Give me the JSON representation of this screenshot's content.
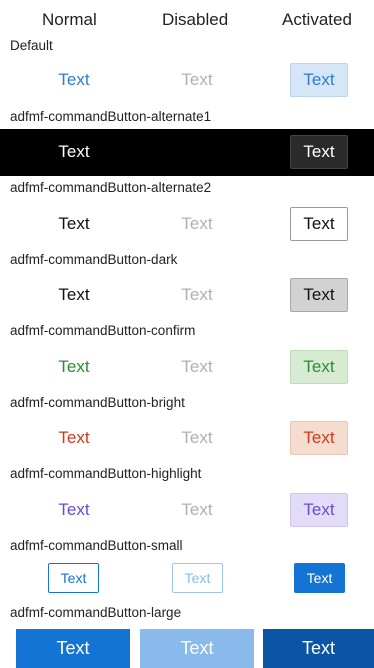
{
  "header": {
    "normal": "Normal",
    "disabled": "Disabled",
    "activated": "Activated"
  },
  "rows": [
    {
      "label": "Default",
      "normal": "Text",
      "disabled": "Text",
      "activated": "Text"
    },
    {
      "label": "adfmf-commandButton-alternate1",
      "normal": "Text",
      "disabled": "Text",
      "activated": "Text"
    },
    {
      "label": "adfmf-commandButton-alternate2",
      "normal": "Text",
      "disabled": "Text",
      "activated": "Text"
    },
    {
      "label": "adfmf-commandButton-dark",
      "normal": "Text",
      "disabled": "Text",
      "activated": "Text"
    },
    {
      "label": "adfmf-commandButton-confirm",
      "normal": "Text",
      "disabled": "Text",
      "activated": "Text"
    },
    {
      "label": "adfmf-commandButton-bright",
      "normal": "Text",
      "disabled": "Text",
      "activated": "Text"
    },
    {
      "label": "adfmf-commandButton-highlight",
      "normal": "Text",
      "disabled": "Text",
      "activated": "Text"
    },
    {
      "label": "adfmf-commandButton-small",
      "normal": "Text",
      "disabled": "Text",
      "activated": "Text"
    },
    {
      "label": "adfmf-commandButton-large",
      "normal": "Text",
      "disabled": "Text",
      "activated": "Text"
    }
  ],
  "colors": {
    "default_blue": "#2f7bd1",
    "disabled_gray": "#b0b0b0",
    "confirm_green": "#2e8b2e",
    "bright_red": "#d03a1c",
    "highlight_purple": "#6a4bd6",
    "large_blue": "#1474d4",
    "large_blue_disabled": "#88bbec",
    "large_blue_active": "#0b56a4"
  }
}
